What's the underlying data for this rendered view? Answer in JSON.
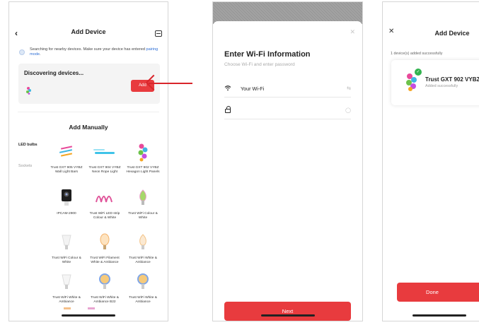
{
  "panel1": {
    "header_title": "Add Device",
    "search_notice_prefix": "Searching for nearby devices. Make sure your device has entered ",
    "search_notice_link": "pairing mode",
    "search_notice_suffix": ".",
    "discovering_title": "Discovering devices...",
    "add_label": "Add",
    "manual_title": "Add Manually",
    "categories": [
      "LED bulbs",
      "Sockets"
    ],
    "products": [
      {
        "label": "Trust GXT 905 VYBZ Wall Light Bars"
      },
      {
        "label": "Trust GXT 904 VYBZ Neon Rope Light"
      },
      {
        "label": "Trust GXT 902 VYBZ Hexagon Light Panels"
      },
      {
        "label": "IPCAM-2900"
      },
      {
        "label": "Trust WiFi LED strip Colour & White"
      },
      {
        "label": "Trust WiFi Colour & White"
      },
      {
        "label": "Trust WiFi Colour & White"
      },
      {
        "label": "Trust WiFi Filament White & Ambiance"
      },
      {
        "label": "Trust WiFi White & Ambiance"
      },
      {
        "label": "Trust WiFi White & Ambiance"
      },
      {
        "label": "Trust WiFi White & Ambiance B22"
      },
      {
        "label": "Trust WiFi White & Ambiance"
      }
    ]
  },
  "panel2": {
    "title": "Enter Wi-Fi Information",
    "subtitle": "Choose Wi-Fi and enter password",
    "wifi_value": "Your Wi-Fi",
    "password_value": "",
    "next_label": "Next"
  },
  "panel3": {
    "header_title": "Add Device",
    "count_text": "1 device(s) added successfully",
    "device_name": "Trust GXT 902 VYBZ",
    "device_status": "Added successfully",
    "done_label": "Done"
  },
  "colors": {
    "accent": "#e83b3e",
    "success": "#32b34f",
    "link": "#2f6fd6"
  }
}
